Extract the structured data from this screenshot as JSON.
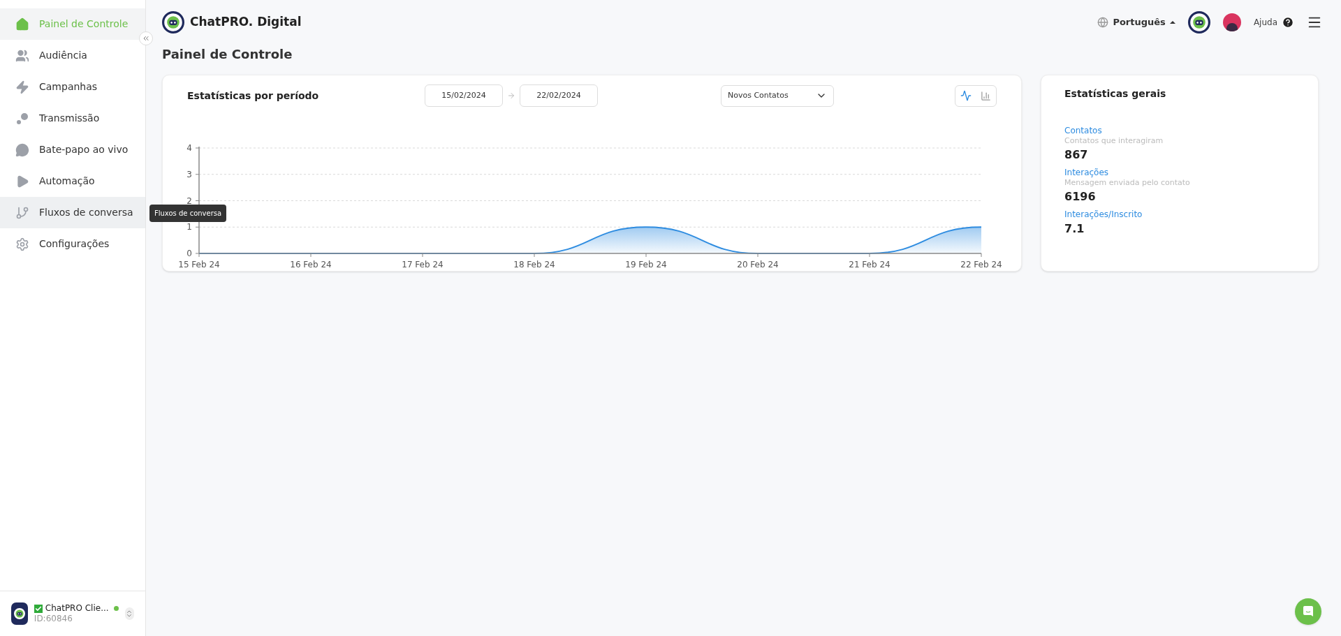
{
  "sidebar": {
    "items": [
      {
        "label": "Painel de Controle",
        "selected": true,
        "hovered": false
      },
      {
        "label": "Audiência",
        "selected": false,
        "hovered": false
      },
      {
        "label": "Campanhas",
        "selected": false,
        "hovered": false
      },
      {
        "label": "Transmissão",
        "selected": false,
        "hovered": false
      },
      {
        "label": "Bate-papo ao vivo",
        "selected": false,
        "hovered": false
      },
      {
        "label": "Automação",
        "selected": false,
        "hovered": false
      },
      {
        "label": "Fluxos de conversa",
        "selected": false,
        "hovered": true
      },
      {
        "label": "Configurações",
        "selected": false,
        "hovered": false
      }
    ],
    "tooltip": "Fluxos de conversa",
    "account": {
      "name": "ChatPRO Clie...",
      "id": "ID:60846",
      "verified": true,
      "online": true
    }
  },
  "header": {
    "brand": "ChatPRO. Digital",
    "language": "Português",
    "help": "Ajuda"
  },
  "page_title": "Painel de Controle",
  "period_stats": {
    "title": "Estatísticas por período",
    "date_from": "15/02/2024",
    "date_to": "22/02/2024",
    "metric": "Novos Contatos",
    "view_line_selected": true,
    "chart_data": {
      "type": "area",
      "categories": [
        "15 Feb 24",
        "16 Feb 24",
        "17 Feb 24",
        "18 Feb 24",
        "19 Feb 24",
        "20 Feb 24",
        "21 Feb 24",
        "22 Feb 24"
      ],
      "series": [
        {
          "color": "#2e8ce0",
          "values": [
            0,
            0,
            0,
            0,
            1,
            0,
            0,
            1
          ]
        }
      ],
      "ylim": [
        0,
        4
      ],
      "yticks": [
        0,
        1,
        2,
        3,
        4
      ],
      "grid": true
    }
  },
  "general_stats": {
    "title": "Estatísticas gerais",
    "items": [
      {
        "label": "Contatos",
        "description": "Contatos que interagiram",
        "value": "867"
      },
      {
        "label": "Interações",
        "description": "Mensagem enviada pelo contato",
        "value": "6196"
      },
      {
        "label": "Interações/Inscrito",
        "value": "7.1"
      }
    ]
  }
}
